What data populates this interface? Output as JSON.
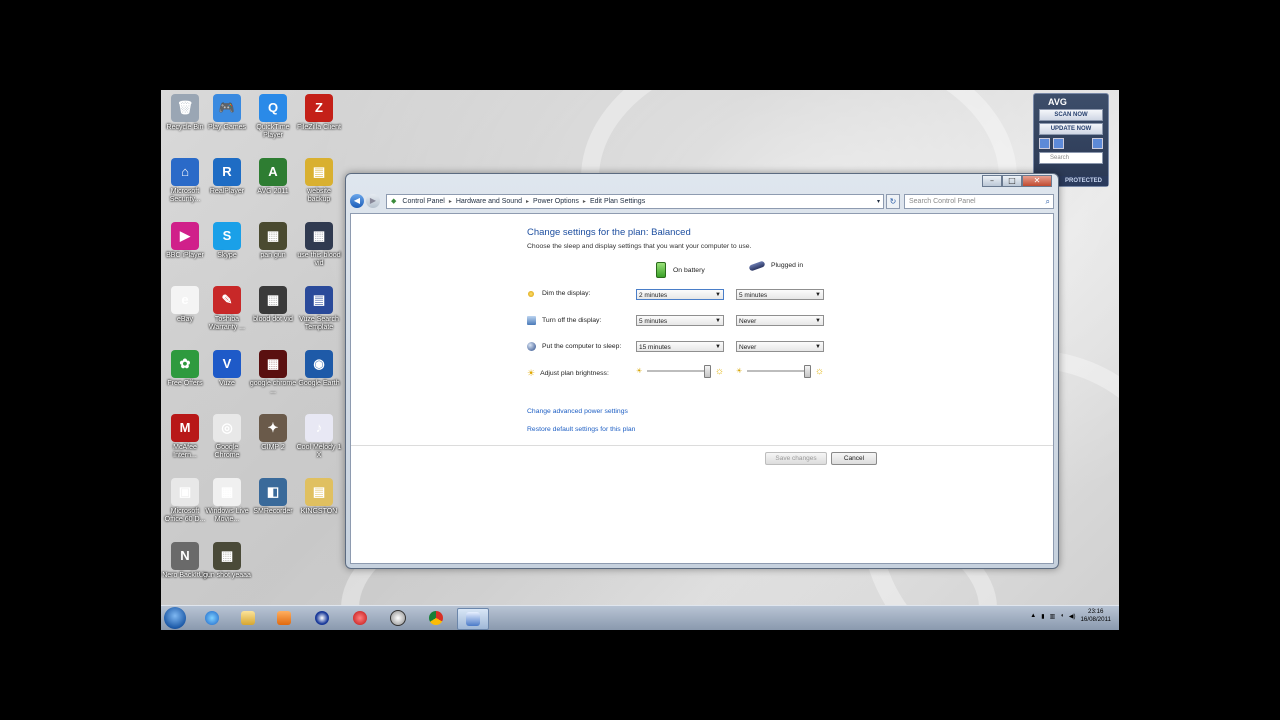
{
  "desktop": {
    "icons": [
      {
        "label": "Recycle Bin",
        "icon": "recycle-bin-icon",
        "color": "#9aa6b4",
        "glyph": "🗑"
      },
      {
        "label": "Play Games",
        "icon": "games-icon",
        "color": "#3a8ae0",
        "glyph": "🎮"
      },
      {
        "label": "QuickTime Player",
        "icon": "quicktime-icon",
        "color": "#2a8ae8",
        "glyph": "Q"
      },
      {
        "label": "FileZilla Client",
        "icon": "filezilla-icon",
        "color": "#c42018",
        "glyph": "Z"
      },
      {
        "label": "Microsoft Security...",
        "icon": "security-essentials-icon",
        "color": "#2a6ac8",
        "glyph": "⌂"
      },
      {
        "label": "RealPlayer",
        "icon": "realplayer-icon",
        "color": "#1e6cc4",
        "glyph": "R"
      },
      {
        "label": "AVG 2011",
        "icon": "avg-icon",
        "color": "#2e7d32",
        "glyph": "A"
      },
      {
        "label": "website backup",
        "icon": "folder-icon",
        "color": "#d9b030",
        "glyph": "▤"
      },
      {
        "label": "BBC iPlayer",
        "icon": "iplayer-icon",
        "color": "#d0208a",
        "glyph": "▶"
      },
      {
        "label": "Skype",
        "icon": "skype-icon",
        "color": "#1aa0e8",
        "glyph": "S"
      },
      {
        "label": "pan gun",
        "icon": "video-file-icon",
        "color": "#4a4a30",
        "glyph": "▦"
      },
      {
        "label": "use this blood vid",
        "icon": "video-file-icon",
        "color": "#303a50",
        "glyph": "▦"
      },
      {
        "label": "eBay",
        "icon": "ebay-icon",
        "color": "#f4f4f4",
        "glyph": "e"
      },
      {
        "label": "Toshiba Warranty ...",
        "icon": "toshiba-icon",
        "color": "#c82828",
        "glyph": "✎"
      },
      {
        "label": "blood dot vid",
        "icon": "video-file-icon",
        "color": "#3a3a3a",
        "glyph": "▦"
      },
      {
        "label": "Vuze Search Template",
        "icon": "vuze-template-icon",
        "color": "#2a4a9a",
        "glyph": "▤"
      },
      {
        "label": "Free Offers",
        "icon": "gift-icon",
        "color": "#2e9a3e",
        "glyph": "✿"
      },
      {
        "label": "Vuze",
        "icon": "vuze-icon",
        "color": "#1e5ac8",
        "glyph": "V"
      },
      {
        "label": "google chrome ...",
        "icon": "video-file-icon",
        "color": "#5a1010",
        "glyph": "▦"
      },
      {
        "label": "Google Earth",
        "icon": "google-earth-icon",
        "color": "#1e5aa8",
        "glyph": "◉"
      },
      {
        "label": "McAfee Intern...",
        "icon": "mcafee-icon",
        "color": "#b81818",
        "glyph": "M"
      },
      {
        "label": "Google Chrome",
        "icon": "chrome-icon",
        "color": "#e8e8e8",
        "glyph": "◎"
      },
      {
        "label": "GIMP 2",
        "icon": "gimp-icon",
        "color": "#6a5a4a",
        "glyph": "✦"
      },
      {
        "label": "Cool Melody 1 X",
        "icon": "mp3-file-icon",
        "color": "#e8e8f4",
        "glyph": "♪"
      },
      {
        "label": "Microsoft Office 60 D...",
        "icon": "office-icon",
        "color": "#e8e8e8",
        "glyph": "▣"
      },
      {
        "label": "Windows Live Movie...",
        "icon": "movie-maker-icon",
        "color": "#f0f0f0",
        "glyph": "▦"
      },
      {
        "label": "SMRecorder",
        "icon": "smrecorder-icon",
        "color": "#3a6a9a",
        "glyph": "◧"
      },
      {
        "label": "KINGSTON",
        "icon": "folder-icon",
        "color": "#e0c060",
        "glyph": "▤"
      },
      {
        "label": "Nero BackItUp",
        "icon": "nero-icon",
        "color": "#6a6a6a",
        "glyph": "N"
      },
      {
        "label": "gun shot yeaaa",
        "icon": "video-file-icon",
        "color": "#4a4a38",
        "glyph": "▦"
      }
    ]
  },
  "avg": {
    "title": "AVG",
    "scan": "SCAN NOW",
    "update": "UPDATE NOW",
    "search_placeholder": "Search",
    "status": "PROTECTED"
  },
  "window": {
    "breadcrumbs": [
      "Control Panel",
      "Hardware and Sound",
      "Power Options",
      "Edit Plan Settings"
    ],
    "search_placeholder": "Search Control Panel",
    "title": "Change settings for the plan: Balanced",
    "description": "Choose the sleep and display settings that you want your computer to use.",
    "col_battery": "On battery",
    "col_plugged": "Plugged in",
    "rows": [
      {
        "label": "Dim the display:",
        "battery": "2 minutes",
        "plugged": "5 minutes"
      },
      {
        "label": "Turn off the display:",
        "battery": "5 minutes",
        "plugged": "Never"
      },
      {
        "label": "Put the computer to sleep:",
        "battery": "15 minutes",
        "plugged": "Never"
      }
    ],
    "brightness_label": "Adjust plan brightness:",
    "brightness_battery": 0.95,
    "brightness_plugged": 0.95,
    "link_advanced": "Change advanced power settings",
    "link_restore": "Restore default settings for this plan",
    "save_label": "Save changes",
    "cancel_label": "Cancel"
  },
  "taskbar": {
    "time": "23:16",
    "date": "16/08/2011"
  }
}
